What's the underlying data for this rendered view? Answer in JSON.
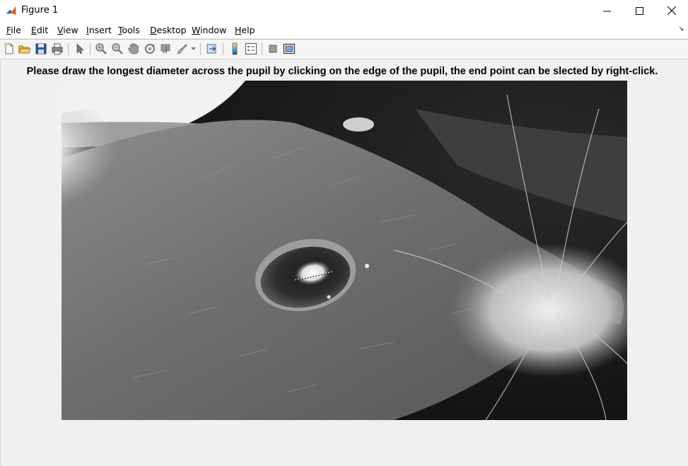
{
  "window": {
    "title": "Figure 1",
    "minimize_icon": "minimize-icon",
    "maximize_icon": "maximize-icon",
    "close_icon": "close-icon"
  },
  "menu": {
    "items": [
      {
        "underline": "F",
        "rest": "ile"
      },
      {
        "underline": "E",
        "rest": "dit"
      },
      {
        "underline": "V",
        "rest": "iew"
      },
      {
        "underline": "I",
        "rest": "nsert"
      },
      {
        "underline": "T",
        "rest": "ools"
      },
      {
        "underline": "D",
        "rest": "esktop"
      },
      {
        "underline": "W",
        "rest": "indow"
      },
      {
        "underline": "H",
        "rest": "elp"
      }
    ]
  },
  "toolbar": {
    "icons": [
      "new-figure-icon",
      "open-file-icon",
      "save-icon",
      "print-icon",
      "select-arrow-icon",
      "zoom-in-icon",
      "zoom-out-icon",
      "pan-icon",
      "rotate-3d-icon",
      "data-cursor-icon",
      "brush-icon",
      "link-plot-icon",
      "colorbar-icon",
      "legend-icon",
      "hide-plot-tools-icon",
      "show-plot-tools-icon"
    ]
  },
  "figure": {
    "axes_title": "Please draw the longest diameter across the pupil by clicking on the edge of the pupil, the end point can be slected by right-click."
  },
  "colors": {
    "background": "#f0f0f0",
    "titlebar": "#ffffff",
    "toolbar": "#f5f5f5"
  }
}
